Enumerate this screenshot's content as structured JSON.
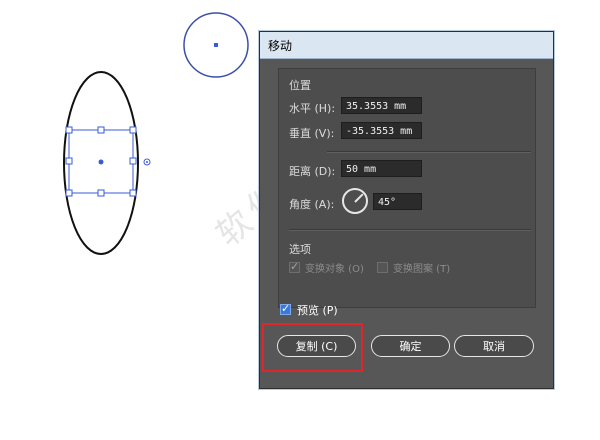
{
  "watermark": "软件自学网",
  "dialog": {
    "title": "移动",
    "position_section": "位置",
    "horizontal_label": "水平 (H):",
    "horizontal_value": "35.3553 mm",
    "vertical_label": "垂直 (V):",
    "vertical_value": "-35.3553 mm",
    "distance_label": "距离 (D):",
    "distance_value": "50 mm",
    "angle_label": "角度 (A):",
    "angle_value": "45°",
    "options_section": "选项",
    "transform_objects_label": "变换对象 (O)",
    "transform_pattern_label": "变换图案 (T)",
    "preview_label": "预览 (P)",
    "copy_button": "复制 (C)",
    "ok_button": "确定",
    "cancel_button": "取消"
  },
  "colors": {
    "dialog_bg": "#575757",
    "titlebar_bg": "#dbe6f3",
    "highlight_border": "#e0262b",
    "selection_blue": "#3a5bd9"
  },
  "icons": [
    "angle-dial-icon",
    "checkmark-icon"
  ]
}
